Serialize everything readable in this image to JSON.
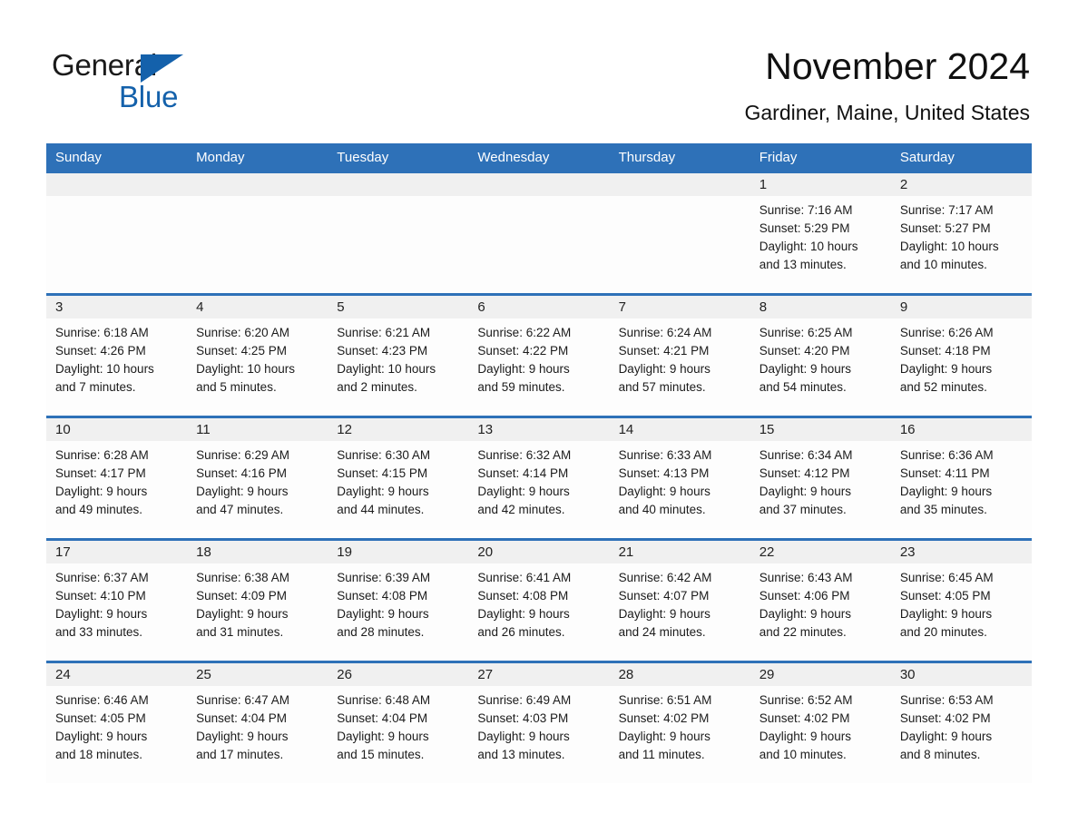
{
  "brand": {
    "logo_line1": "General",
    "logo_line2": "Blue",
    "logo_triangle_icon": "triangle-icon",
    "accent_blue": "#1461ab",
    "header_blue": "#2e71b8",
    "daynum_band_gray": "#f0f0f0"
  },
  "header": {
    "month_title": "November 2024",
    "location": "Gardiner, Maine, United States"
  },
  "calendar": {
    "weekday_headers": [
      "Sunday",
      "Monday",
      "Tuesday",
      "Wednesday",
      "Thursday",
      "Friday",
      "Saturday"
    ],
    "weeks": [
      [
        {
          "day": "",
          "lines": []
        },
        {
          "day": "",
          "lines": []
        },
        {
          "day": "",
          "lines": []
        },
        {
          "day": "",
          "lines": []
        },
        {
          "day": "",
          "lines": []
        },
        {
          "day": "1",
          "lines": [
            "Sunrise: 7:16 AM",
            "Sunset: 5:29 PM",
            "Daylight: 10 hours",
            "and 13 minutes."
          ]
        },
        {
          "day": "2",
          "lines": [
            "Sunrise: 7:17 AM",
            "Sunset: 5:27 PM",
            "Daylight: 10 hours",
            "and 10 minutes."
          ]
        }
      ],
      [
        {
          "day": "3",
          "lines": [
            "Sunrise: 6:18 AM",
            "Sunset: 4:26 PM",
            "Daylight: 10 hours",
            "and 7 minutes."
          ]
        },
        {
          "day": "4",
          "lines": [
            "Sunrise: 6:20 AM",
            "Sunset: 4:25 PM",
            "Daylight: 10 hours",
            "and 5 minutes."
          ]
        },
        {
          "day": "5",
          "lines": [
            "Sunrise: 6:21 AM",
            "Sunset: 4:23 PM",
            "Daylight: 10 hours",
            "and 2 minutes."
          ]
        },
        {
          "day": "6",
          "lines": [
            "Sunrise: 6:22 AM",
            "Sunset: 4:22 PM",
            "Daylight: 9 hours",
            "and 59 minutes."
          ]
        },
        {
          "day": "7",
          "lines": [
            "Sunrise: 6:24 AM",
            "Sunset: 4:21 PM",
            "Daylight: 9 hours",
            "and 57 minutes."
          ]
        },
        {
          "day": "8",
          "lines": [
            "Sunrise: 6:25 AM",
            "Sunset: 4:20 PM",
            "Daylight: 9 hours",
            "and 54 minutes."
          ]
        },
        {
          "day": "9",
          "lines": [
            "Sunrise: 6:26 AM",
            "Sunset: 4:18 PM",
            "Daylight: 9 hours",
            "and 52 minutes."
          ]
        }
      ],
      [
        {
          "day": "10",
          "lines": [
            "Sunrise: 6:28 AM",
            "Sunset: 4:17 PM",
            "Daylight: 9 hours",
            "and 49 minutes."
          ]
        },
        {
          "day": "11",
          "lines": [
            "Sunrise: 6:29 AM",
            "Sunset: 4:16 PM",
            "Daylight: 9 hours",
            "and 47 minutes."
          ]
        },
        {
          "day": "12",
          "lines": [
            "Sunrise: 6:30 AM",
            "Sunset: 4:15 PM",
            "Daylight: 9 hours",
            "and 44 minutes."
          ]
        },
        {
          "day": "13",
          "lines": [
            "Sunrise: 6:32 AM",
            "Sunset: 4:14 PM",
            "Daylight: 9 hours",
            "and 42 minutes."
          ]
        },
        {
          "day": "14",
          "lines": [
            "Sunrise: 6:33 AM",
            "Sunset: 4:13 PM",
            "Daylight: 9 hours",
            "and 40 minutes."
          ]
        },
        {
          "day": "15",
          "lines": [
            "Sunrise: 6:34 AM",
            "Sunset: 4:12 PM",
            "Daylight: 9 hours",
            "and 37 minutes."
          ]
        },
        {
          "day": "16",
          "lines": [
            "Sunrise: 6:36 AM",
            "Sunset: 4:11 PM",
            "Daylight: 9 hours",
            "and 35 minutes."
          ]
        }
      ],
      [
        {
          "day": "17",
          "lines": [
            "Sunrise: 6:37 AM",
            "Sunset: 4:10 PM",
            "Daylight: 9 hours",
            "and 33 minutes."
          ]
        },
        {
          "day": "18",
          "lines": [
            "Sunrise: 6:38 AM",
            "Sunset: 4:09 PM",
            "Daylight: 9 hours",
            "and 31 minutes."
          ]
        },
        {
          "day": "19",
          "lines": [
            "Sunrise: 6:39 AM",
            "Sunset: 4:08 PM",
            "Daylight: 9 hours",
            "and 28 minutes."
          ]
        },
        {
          "day": "20",
          "lines": [
            "Sunrise: 6:41 AM",
            "Sunset: 4:08 PM",
            "Daylight: 9 hours",
            "and 26 minutes."
          ]
        },
        {
          "day": "21",
          "lines": [
            "Sunrise: 6:42 AM",
            "Sunset: 4:07 PM",
            "Daylight: 9 hours",
            "and 24 minutes."
          ]
        },
        {
          "day": "22",
          "lines": [
            "Sunrise: 6:43 AM",
            "Sunset: 4:06 PM",
            "Daylight: 9 hours",
            "and 22 minutes."
          ]
        },
        {
          "day": "23",
          "lines": [
            "Sunrise: 6:45 AM",
            "Sunset: 4:05 PM",
            "Daylight: 9 hours",
            "and 20 minutes."
          ]
        }
      ],
      [
        {
          "day": "24",
          "lines": [
            "Sunrise: 6:46 AM",
            "Sunset: 4:05 PM",
            "Daylight: 9 hours",
            "and 18 minutes."
          ]
        },
        {
          "day": "25",
          "lines": [
            "Sunrise: 6:47 AM",
            "Sunset: 4:04 PM",
            "Daylight: 9 hours",
            "and 17 minutes."
          ]
        },
        {
          "day": "26",
          "lines": [
            "Sunrise: 6:48 AM",
            "Sunset: 4:04 PM",
            "Daylight: 9 hours",
            "and 15 minutes."
          ]
        },
        {
          "day": "27",
          "lines": [
            "Sunrise: 6:49 AM",
            "Sunset: 4:03 PM",
            "Daylight: 9 hours",
            "and 13 minutes."
          ]
        },
        {
          "day": "28",
          "lines": [
            "Sunrise: 6:51 AM",
            "Sunset: 4:02 PM",
            "Daylight: 9 hours",
            "and 11 minutes."
          ]
        },
        {
          "day": "29",
          "lines": [
            "Sunrise: 6:52 AM",
            "Sunset: 4:02 PM",
            "Daylight: 9 hours",
            "and 10 minutes."
          ]
        },
        {
          "day": "30",
          "lines": [
            "Sunrise: 6:53 AM",
            "Sunset: 4:02 PM",
            "Daylight: 9 hours",
            "and 8 minutes."
          ]
        }
      ]
    ]
  }
}
